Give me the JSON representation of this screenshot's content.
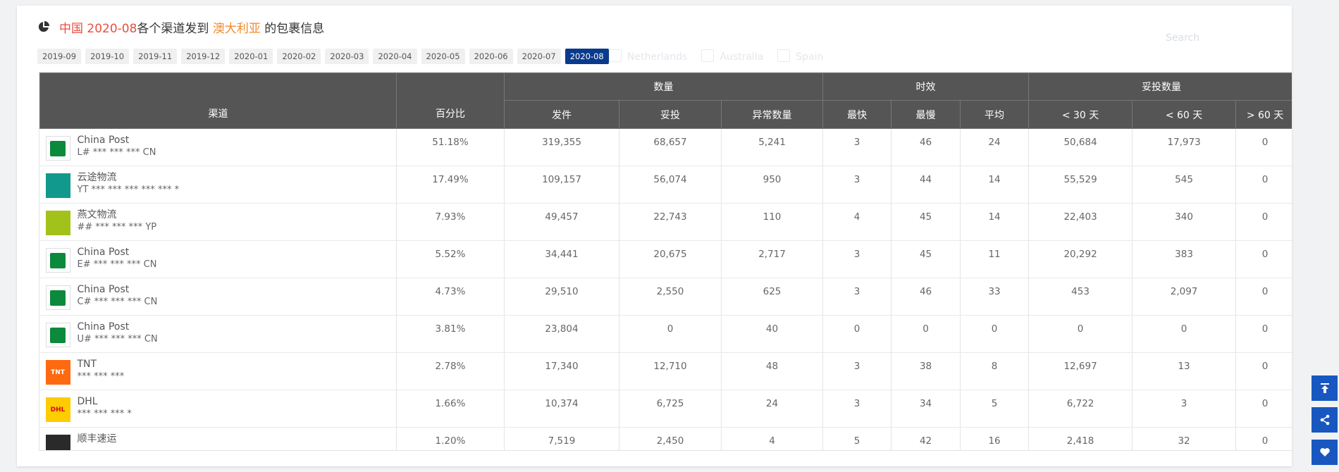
{
  "title": {
    "origin": "中国",
    "month": "2020-08",
    "mid": "各个渠道发到",
    "dest": "澳大利亚",
    "suffix": "的包裹信息"
  },
  "ghost": {
    "search": "Search",
    "legend": [
      "Netherlands",
      "Australia",
      "Spain"
    ]
  },
  "month_tabs": [
    "2019-09",
    "2019-10",
    "2019-11",
    "2019-12",
    "2020-01",
    "2020-02",
    "2020-03",
    "2020-04",
    "2020-05",
    "2020-06",
    "2020-07",
    "2020-08"
  ],
  "active_month": "2020-08",
  "headers": {
    "channel": "渠道",
    "percent": "百分比",
    "quantity": "数量",
    "timeliness": "时效",
    "delivered_count": "妥投数量",
    "sent": "发件",
    "delivered": "妥投",
    "abnormal": "异常数量",
    "fastest": "最快",
    "slowest": "最慢",
    "average": "平均",
    "lt30": "< 30 天",
    "lt60": "< 60 天",
    "gt60": "> 60 天"
  },
  "rows": [
    {
      "logo": "china-post",
      "name": "China Post",
      "code": "L# *** *** *** CN",
      "percent": "51.18%",
      "sent": "319,355",
      "delivered": "68,657",
      "abnormal": "5,241",
      "fastest": "3",
      "slowest": "46",
      "average": "24",
      "lt30": "50,684",
      "lt60": "17,973",
      "gt60": "0"
    },
    {
      "logo": "yuntu",
      "name": "云途物流",
      "code": "YT *** *** *** *** *** *",
      "percent": "17.49%",
      "sent": "109,157",
      "delivered": "56,074",
      "abnormal": "950",
      "fastest": "3",
      "slowest": "44",
      "average": "14",
      "lt30": "55,529",
      "lt60": "545",
      "gt60": "0"
    },
    {
      "logo": "yanwen",
      "name": "燕文物流",
      "code": "## *** *** *** YP",
      "percent": "7.93%",
      "sent": "49,457",
      "delivered": "22,743",
      "abnormal": "110",
      "fastest": "4",
      "slowest": "45",
      "average": "14",
      "lt30": "22,403",
      "lt60": "340",
      "gt60": "0"
    },
    {
      "logo": "china-post",
      "name": "China Post",
      "code": "E# *** *** *** CN",
      "percent": "5.52%",
      "sent": "34,441",
      "delivered": "20,675",
      "abnormal": "2,717",
      "fastest": "3",
      "slowest": "45",
      "average": "11",
      "lt30": "20,292",
      "lt60": "383",
      "gt60": "0"
    },
    {
      "logo": "china-post",
      "name": "China Post",
      "code": "C# *** *** *** CN",
      "percent": "4.73%",
      "sent": "29,510",
      "delivered": "2,550",
      "abnormal": "625",
      "fastest": "3",
      "slowest": "46",
      "average": "33",
      "lt30": "453",
      "lt60": "2,097",
      "gt60": "0"
    },
    {
      "logo": "china-post",
      "name": "China Post",
      "code": "U# *** *** *** CN",
      "percent": "3.81%",
      "sent": "23,804",
      "delivered": "0",
      "abnormal": "40",
      "fastest": "0",
      "slowest": "0",
      "average": "0",
      "lt30": "0",
      "lt60": "0",
      "gt60": "0"
    },
    {
      "logo": "tnt",
      "name": "TNT",
      "code": "*** *** ***",
      "percent": "2.78%",
      "sent": "17,340",
      "delivered": "12,710",
      "abnormal": "48",
      "fastest": "3",
      "slowest": "38",
      "average": "8",
      "lt30": "12,697",
      "lt60": "13",
      "gt60": "0"
    },
    {
      "logo": "dhl",
      "name": "DHL",
      "code": "*** *** *** *",
      "percent": "1.66%",
      "sent": "10,374",
      "delivered": "6,725",
      "abnormal": "24",
      "fastest": "3",
      "slowest": "34",
      "average": "5",
      "lt30": "6,722",
      "lt60": "3",
      "gt60": "0"
    },
    {
      "logo": "sf",
      "name": "顺丰速运",
      "code": "",
      "percent": "1.20%",
      "sent": "7,519",
      "delivered": "2,450",
      "abnormal": "4",
      "fastest": "5",
      "slowest": "42",
      "average": "16",
      "lt30": "2,418",
      "lt60": "32",
      "gt60": "0"
    }
  ],
  "logo_text": {
    "dhl": "DHL",
    "tnt": "TNT"
  },
  "colors": {
    "accent": "#0a3a8c",
    "side_buttons": "#1857c0",
    "header": "#555555",
    "title_red": "#e84e3f",
    "title_orange": "#f08a2c"
  },
  "side_buttons": [
    "back-to-top-icon",
    "share-icon",
    "heart-icon"
  ]
}
